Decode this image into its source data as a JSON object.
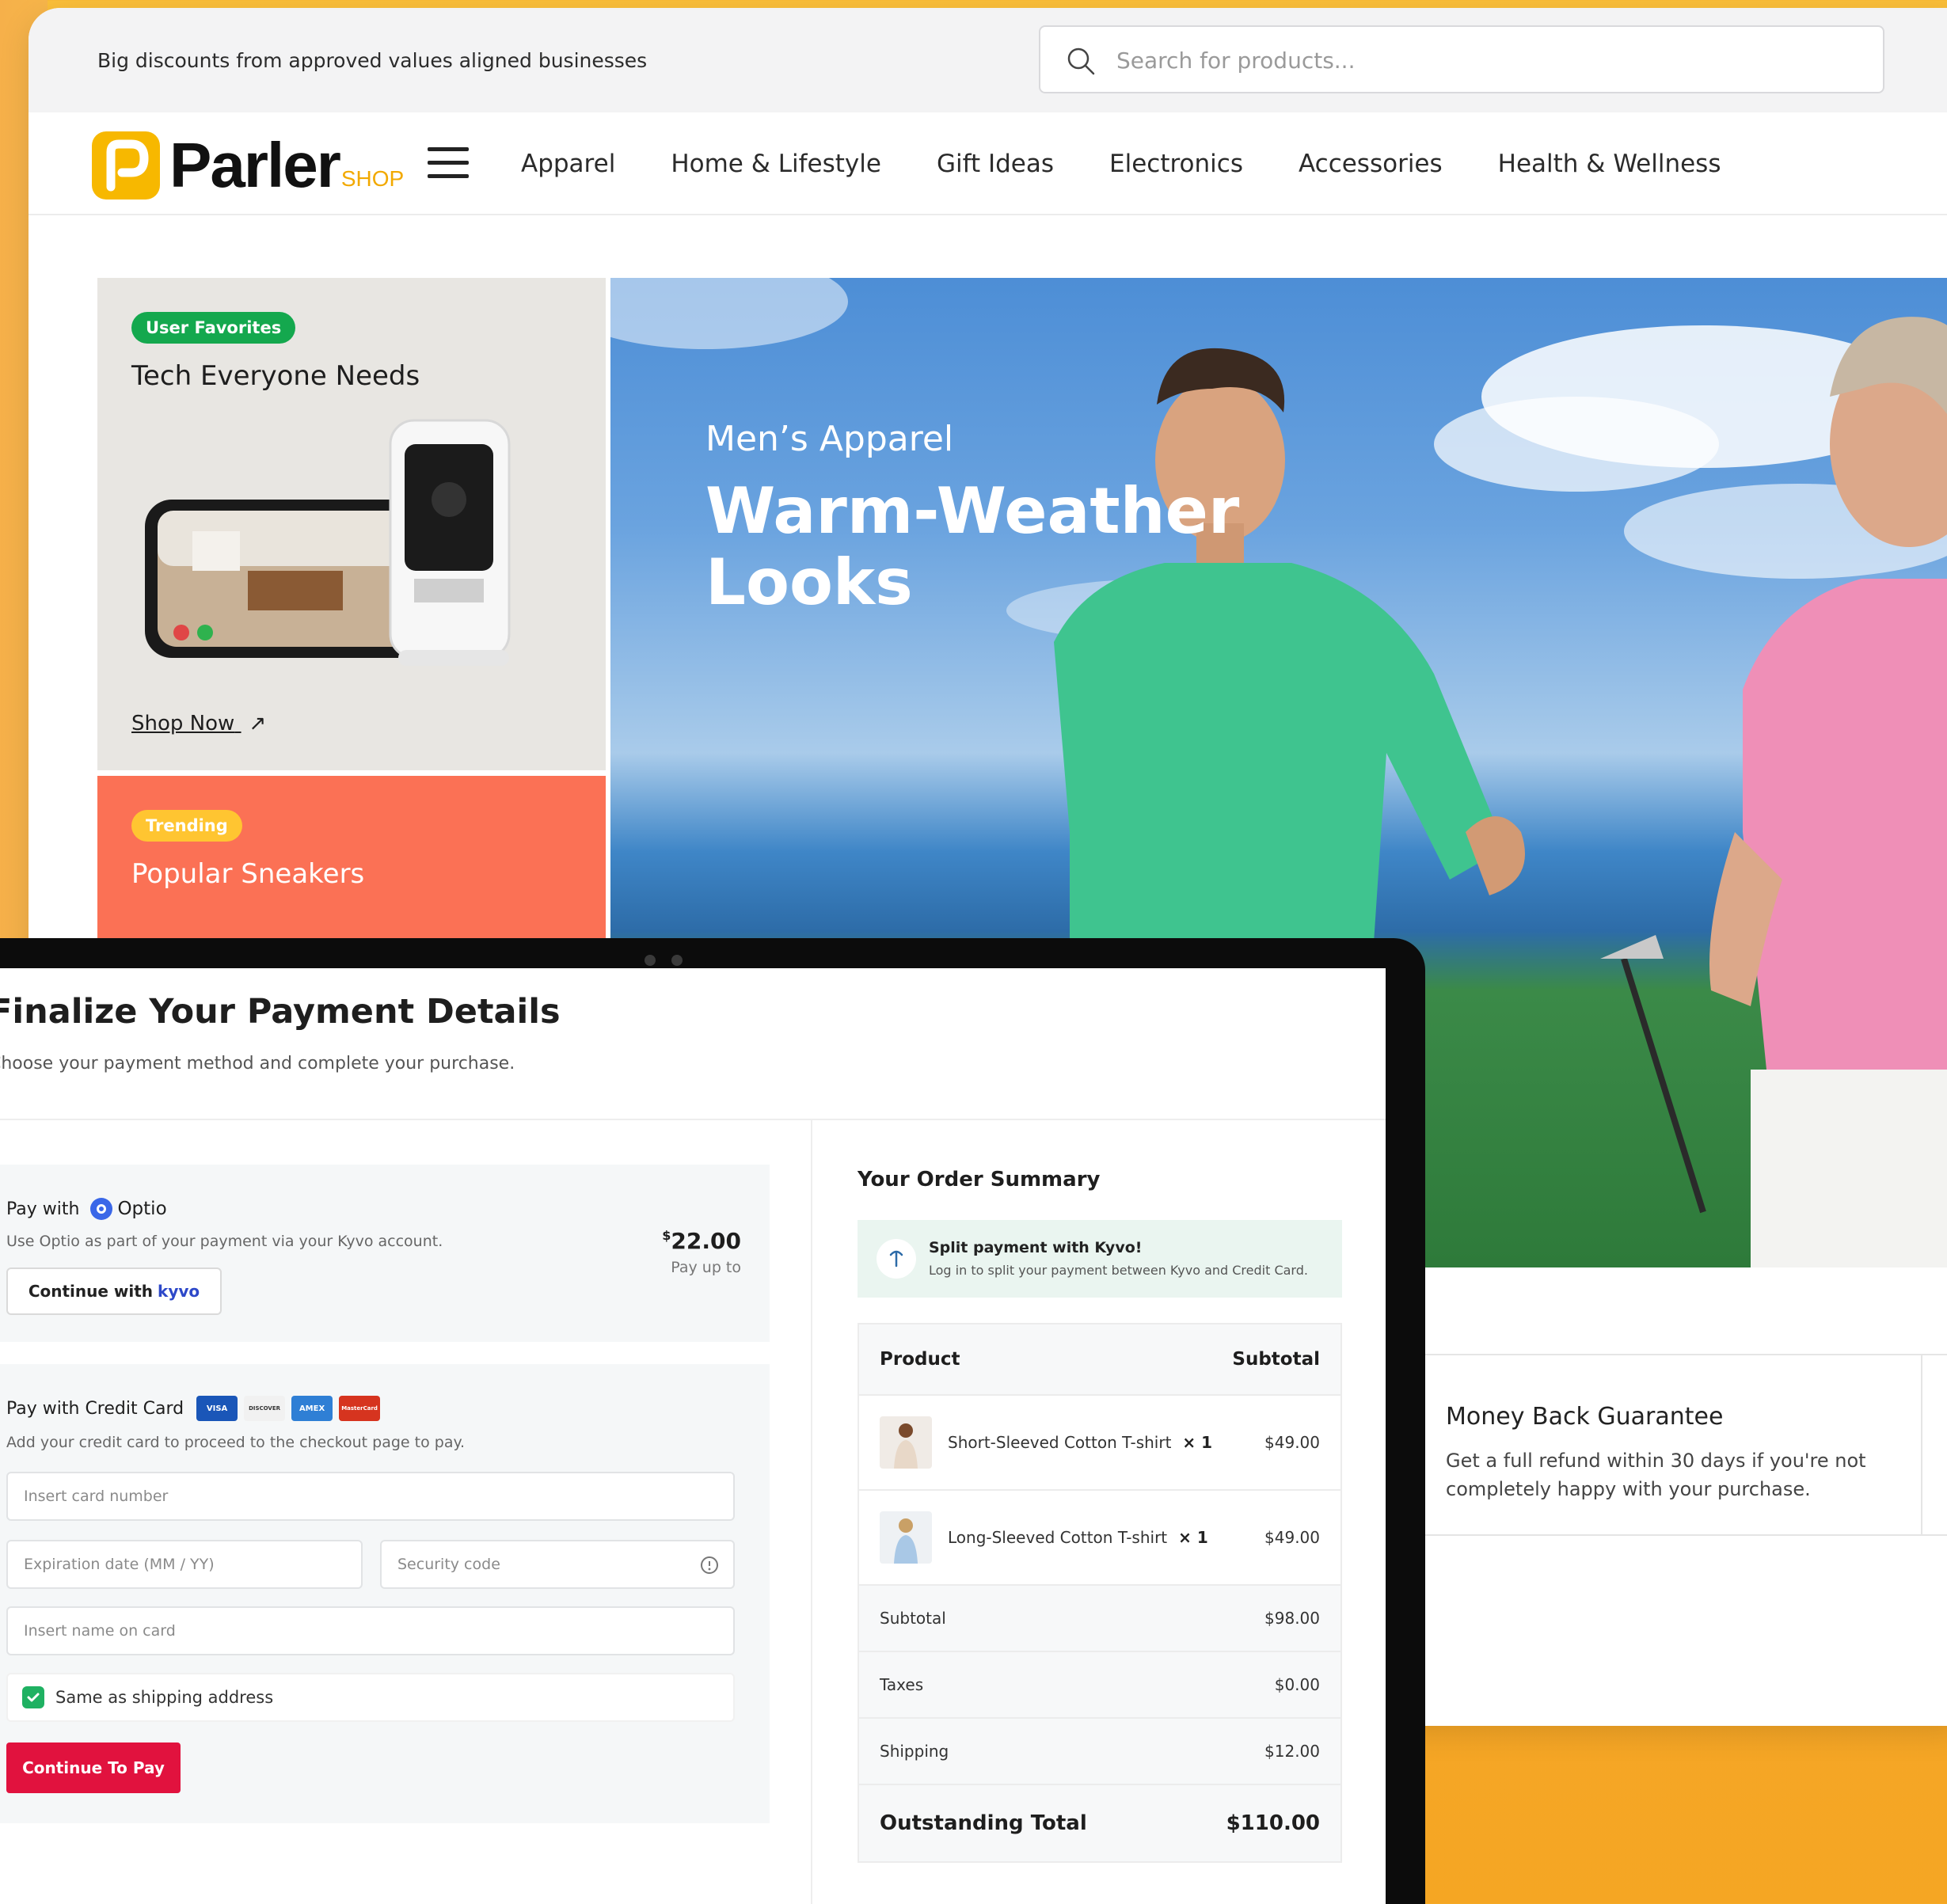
{
  "colors": {
    "brand_yellow": "#f7b800",
    "badge_green": "#14a84e",
    "trending_orange": "#fb7155",
    "trending_yellow": "#ffc531",
    "pay_button_red": "#e1123e",
    "optio_blue": "#3a67e8",
    "check_green": "#1fb162"
  },
  "topbar": {
    "promo": "Big discounts from approved values aligned businesses",
    "search_placeholder": "Search for products..."
  },
  "logo": {
    "name": "Parler",
    "suffix": "SHOP"
  },
  "nav": {
    "menu_icon": "hamburger-icon",
    "links": [
      "Apparel",
      "Home & Lifestyle",
      "Gift Ideas",
      "Electronics",
      "Accessories",
      "Health & Wellness"
    ]
  },
  "tiles": {
    "tech": {
      "badge": "User Favorites",
      "title": "Tech Everyone Needs",
      "cta": "Shop Now",
      "cta_icon": "arrow-up-right-icon"
    },
    "sneakers": {
      "badge": "Trending",
      "title": "Popular Sneakers"
    }
  },
  "hero": {
    "subtitle": "Men’s Apparel",
    "title": "Warm-Weather Looks"
  },
  "guarantee": {
    "title": "Money Back Guarantee",
    "description": "Get a full refund within 30 days if you're not completely happy with your purchase."
  },
  "payment": {
    "title": "Finalize Your Payment Details",
    "subtitle": "Choose your payment method and complete your purchase.",
    "optio": {
      "pay_with": "Pay with",
      "name": "Optio",
      "description": "Use Optio as part of your payment via your Kyvo account.",
      "button_label": "Continue with",
      "button_brand": "kyvo",
      "amount_currency": "$",
      "amount": "22.00",
      "amount_note": "Pay up to"
    },
    "credit_card": {
      "label": "Pay with Credit Card",
      "cards": [
        "VISA",
        "DISCOVER",
        "AMEX",
        "MasterCard"
      ],
      "description": "Add your credit card to proceed to the checkout page to pay.",
      "card_number_placeholder": "Insert card number",
      "expiration_placeholder": "Expiration date (MM / YY)",
      "security_placeholder": "Security code",
      "name_placeholder": "Insert name on card",
      "same_as_shipping": "Same as shipping address",
      "same_as_shipping_checked": true,
      "submit": "Continue To Pay"
    }
  },
  "order_summary": {
    "title": "Your Order Summary",
    "split": {
      "title": "Split payment with Kyvo!",
      "description": "Log in to split your payment between Kyvo and Credit Card."
    },
    "columns": [
      "Product",
      "Subtotal"
    ],
    "items": [
      {
        "name": "Short-Sleeved Cotton T-shirt",
        "qty": "× 1",
        "price": "$49.00"
      },
      {
        "name": "Long-Sleeved Cotton T-shirt",
        "qty": "× 1",
        "price": "$49.00"
      }
    ],
    "subtotal_label": "Subtotal",
    "subtotal": "$98.00",
    "taxes_label": "Taxes",
    "taxes": "$0.00",
    "shipping_label": "Shipping",
    "shipping": "$12.00",
    "total_label": "Outstanding Total",
    "total": "$110.00"
  }
}
